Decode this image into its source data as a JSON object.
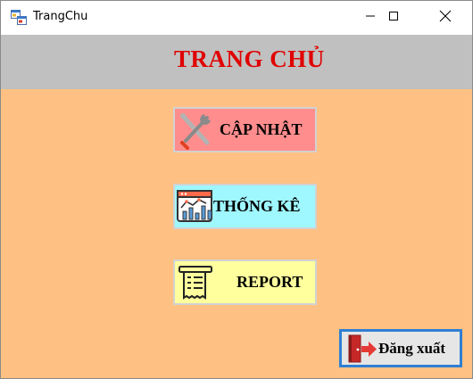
{
  "window": {
    "title": "TrangChu",
    "controls": {
      "minimize_icon": "minimize-icon",
      "maximize_icon": "maximize-icon",
      "close_icon": "close-icon"
    }
  },
  "header": {
    "title": "TRANG CHỦ"
  },
  "menu": {
    "update": {
      "label": "CẬP NHẬT",
      "icon": "tools-icon",
      "color": "#ff8d8d"
    },
    "stats": {
      "label": "THỐNG KÊ",
      "icon": "chart-icon",
      "color": "#9ff7ff"
    },
    "report": {
      "label": "REPORT",
      "icon": "receipt-icon",
      "color": "#ffff9d"
    }
  },
  "logout": {
    "label": "Đăng xuất",
    "icon": "exit-door-icon",
    "border_color": "#2f7fd4"
  },
  "colors": {
    "background": "#fec183",
    "header_band": "#c0c0c0",
    "title_red": "#e00000"
  }
}
